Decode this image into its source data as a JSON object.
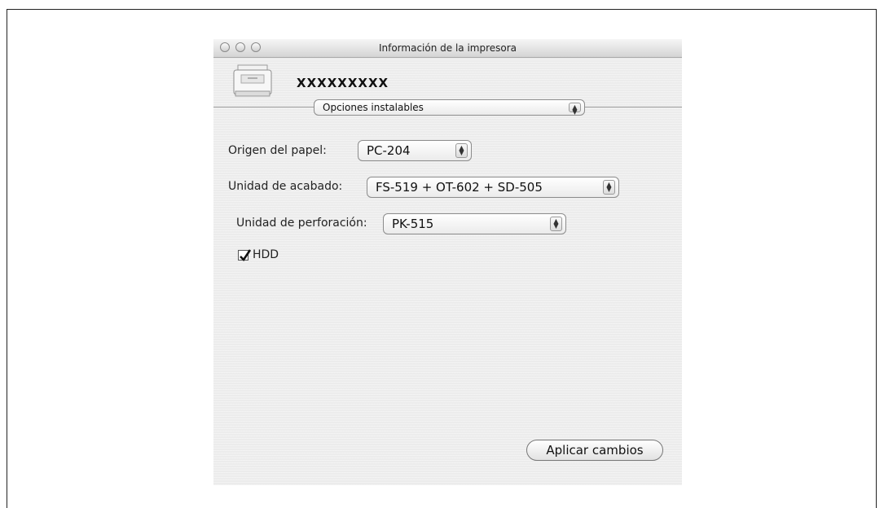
{
  "window": {
    "title": "Información de la impresora",
    "printer_name": "XXXXXXXXX"
  },
  "section_popup": {
    "value": "Opciones instalables"
  },
  "fields": {
    "paper_source": {
      "label": "Origen del papel:",
      "value": "PC-204"
    },
    "finisher": {
      "label": "Unidad de acabado:",
      "value": "FS-519 + OT-602 + SD-505"
    },
    "punch": {
      "label": "Unidad de perforación:",
      "value": "PK-515"
    }
  },
  "hdd": {
    "label": "HDD",
    "checked": true
  },
  "apply_button": {
    "label": "Aplicar cambios"
  },
  "icons": [
    "close-button",
    "minimize-button",
    "zoom-button",
    "printer-icon",
    "popup-arrows-icon",
    "checkmark-icon"
  ]
}
